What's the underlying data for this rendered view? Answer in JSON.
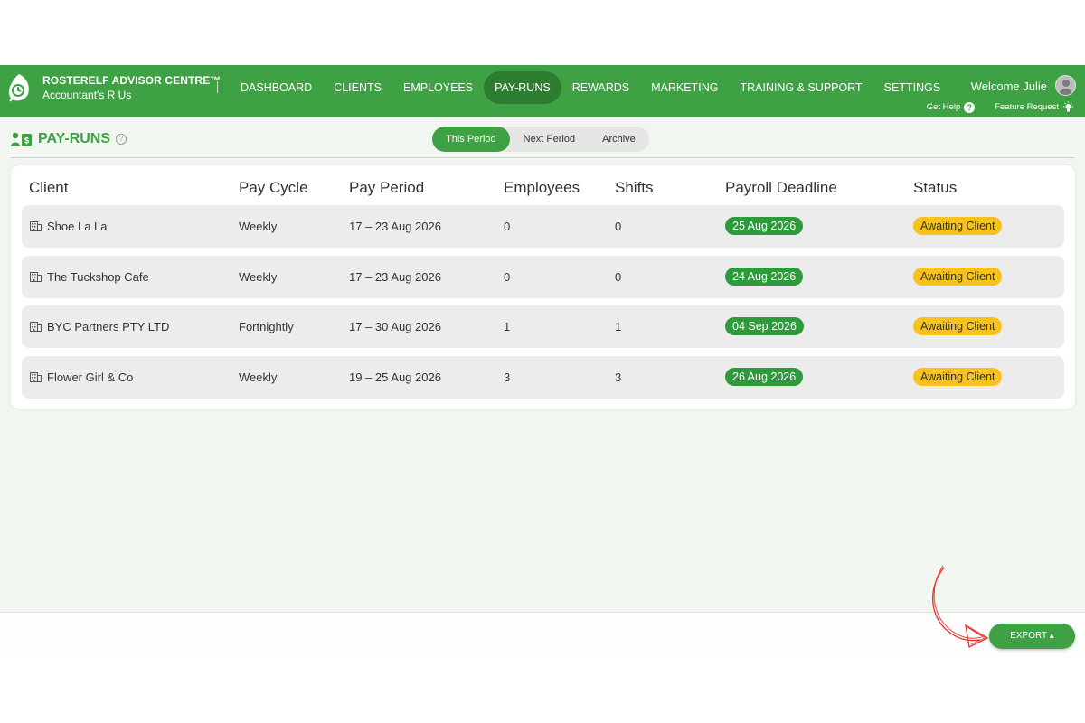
{
  "brand": {
    "title": "ROSTERELF ADVISOR CENTRE™",
    "subtitle": "Accountant's R Us"
  },
  "nav": [
    {
      "label": "DASHBOARD",
      "active": false
    },
    {
      "label": "CLIENTS",
      "active": false
    },
    {
      "label": "EMPLOYEES",
      "active": false
    },
    {
      "label": "PAY-RUNS",
      "active": true
    },
    {
      "label": "REWARDS",
      "active": false
    },
    {
      "label": "MARKETING",
      "active": false
    },
    {
      "label": "TRAINING & SUPPORT",
      "active": false
    },
    {
      "label": "SETTINGS",
      "active": false
    }
  ],
  "user": {
    "welcome": "Welcome Julie"
  },
  "help": {
    "get_help": "Get Help",
    "feature_request": "Feature Request"
  },
  "page": {
    "title": "PAY-RUNS"
  },
  "tabs": [
    {
      "label": "This Period",
      "active": true
    },
    {
      "label": "Next Period",
      "active": false
    },
    {
      "label": "Archive",
      "active": false
    }
  ],
  "table": {
    "headers": [
      "Client",
      "Pay Cycle",
      "Pay Period",
      "Employees",
      "Shifts",
      "Payroll Deadline",
      "Status"
    ],
    "rows": [
      {
        "client": "Shoe La La",
        "cycle": "Weekly",
        "period": "17 – 23 Aug 2026",
        "employees": "0",
        "shifts": "0",
        "deadline": "25 Aug 2026",
        "status": "Awaiting Client"
      },
      {
        "client": "The Tuckshop Cafe",
        "cycle": "Weekly",
        "period": "17 – 23 Aug 2026",
        "employees": "0",
        "shifts": "0",
        "deadline": "24 Aug 2026",
        "status": "Awaiting Client"
      },
      {
        "client": "BYC Partners PTY LTD",
        "cycle": "Fortnightly",
        "period": "17 – 30 Aug 2026",
        "employees": "1",
        "shifts": "1",
        "deadline": "04 Sep 2026",
        "status": "Awaiting Client"
      },
      {
        "client": "Flower Girl & Co",
        "cycle": "Weekly",
        "period": "19 – 25 Aug 2026",
        "employees": "3",
        "shifts": "3",
        "deadline": "26 Aug 2026",
        "status": "Awaiting Client"
      }
    ]
  },
  "footer": {
    "export_label": "EXPORT ▴"
  },
  "colors": {
    "brand_green": "#3ea143",
    "active_nav": "#2d7d31",
    "deadline_pill": "#2e9a3c",
    "status_pill": "#f7c21b",
    "annotation_arrow": "#e53935"
  }
}
